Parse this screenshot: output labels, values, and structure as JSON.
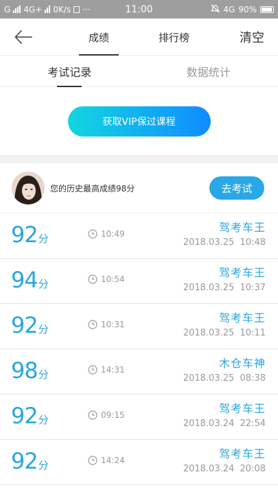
{
  "status_bar": {
    "carrier": "G",
    "network1": "4G+",
    "speed": "0K/s",
    "more": "···",
    "time": "11:00",
    "network2": "4G",
    "battery": "90%"
  },
  "nav": {
    "tabs": [
      "成绩",
      "排行榜"
    ],
    "active_tab": 0,
    "clear_label": "清空"
  },
  "subtabs": [
    "考试记录",
    "数据统计"
  ],
  "vip_button": "获取VIP保过课程",
  "best": {
    "text": "您的历史最高成绩98分",
    "exam_button": "去考试"
  },
  "score_unit": "分",
  "records": [
    {
      "score": "92",
      "duration": "10:49",
      "title": "驾考车王",
      "date": "2018.03.25",
      "clock": "10:48"
    },
    {
      "score": "94",
      "duration": "10:54",
      "title": "驾考车王",
      "date": "2018.03.25",
      "clock": "10:37"
    },
    {
      "score": "92",
      "duration": "10:31",
      "title": "驾考车王",
      "date": "2018.03.25",
      "clock": "10:11"
    },
    {
      "score": "98",
      "duration": "14:31",
      "title": "木仓车神",
      "date": "2018.03.25",
      "clock": "08:38"
    },
    {
      "score": "92",
      "duration": "09:15",
      "title": "驾考车王",
      "date": "2018.03.24",
      "clock": "22:54"
    },
    {
      "score": "92",
      "duration": "14:24",
      "title": "驾考车王",
      "date": "2018.03.24",
      "clock": "20:08"
    }
  ],
  "colors": {
    "accent": "#29a6dc",
    "vip_gradient_start": "#12d6e0",
    "vip_gradient_end": "#0f8cff",
    "status_bar": "#9e9e9e"
  }
}
